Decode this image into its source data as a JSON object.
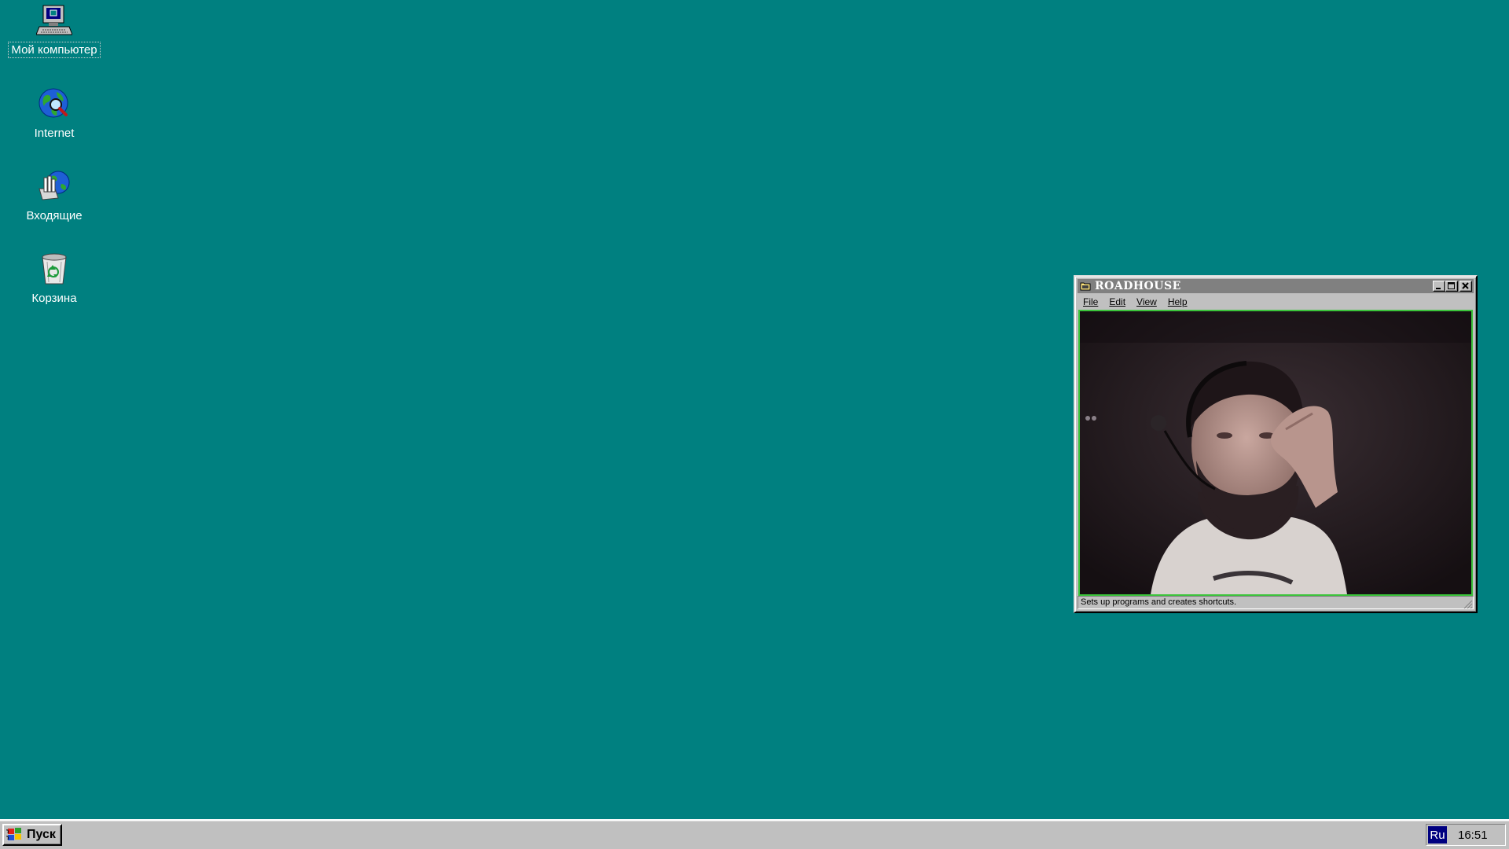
{
  "desktop": {
    "background_color": "#008080",
    "icons": [
      {
        "label": "Мой компьютер",
        "icon": "my-computer-icon"
      },
      {
        "label": "Internet",
        "icon": "internet-globe-icon"
      },
      {
        "label": "Входящие",
        "icon": "inbox-icon"
      },
      {
        "label": "Корзина",
        "icon": "recycle-bin-icon"
      }
    ]
  },
  "window": {
    "title": "ROADHOUSE",
    "title_icon": "folder-icon",
    "controls": [
      "minimize-icon",
      "maximize-icon",
      "close-icon"
    ],
    "menu": [
      "File",
      "Edit",
      "View",
      "Help"
    ],
    "content": "webcam video feed",
    "status_text": "Sets up programs and creates shortcuts."
  },
  "taskbar": {
    "start_label": "Пуск",
    "start_icon": "windows-flag-icon",
    "language": "Ru",
    "clock": "16:51"
  }
}
